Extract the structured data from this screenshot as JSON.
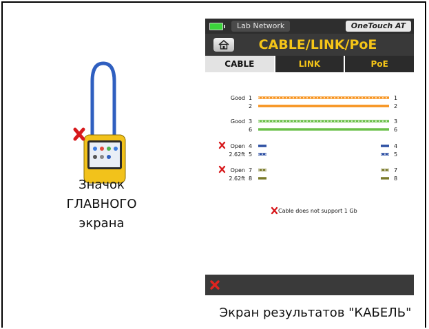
{
  "left_caption": [
    "Значок",
    "ГЛАВНОГО",
    "экрана"
  ],
  "bottom_caption": "Экран результатов \"КАБЕЛЬ\"",
  "status": {
    "network": "Lab Network",
    "device": "OneTouch AT"
  },
  "header": {
    "title": "CABLE/LINK/PoE"
  },
  "tabs": [
    {
      "label": "CABLE"
    },
    {
      "label": "LINK"
    },
    {
      "label": "PoE"
    }
  ],
  "colors": {
    "accent": "#f5c518",
    "pair12": "#f7931e",
    "pair36": "#6cc04a",
    "pair45": "#2c4fa3",
    "pair78": "#7a7a2a",
    "fail": "#d7191c"
  },
  "pairs": [
    {
      "status": "Good",
      "length": "",
      "pins": [
        "1",
        "2"
      ],
      "fault": false
    },
    {
      "status": "Good",
      "length": "",
      "pins": [
        "3",
        "6"
      ],
      "fault": false
    },
    {
      "status": "Open",
      "length": "2.62ft",
      "pins": [
        "4",
        "5"
      ],
      "fault": true
    },
    {
      "status": "Open",
      "length": "2.62ft",
      "pins": [
        "7",
        "8"
      ],
      "fault": true
    }
  ],
  "note": "Cable does not support 1 Gb"
}
